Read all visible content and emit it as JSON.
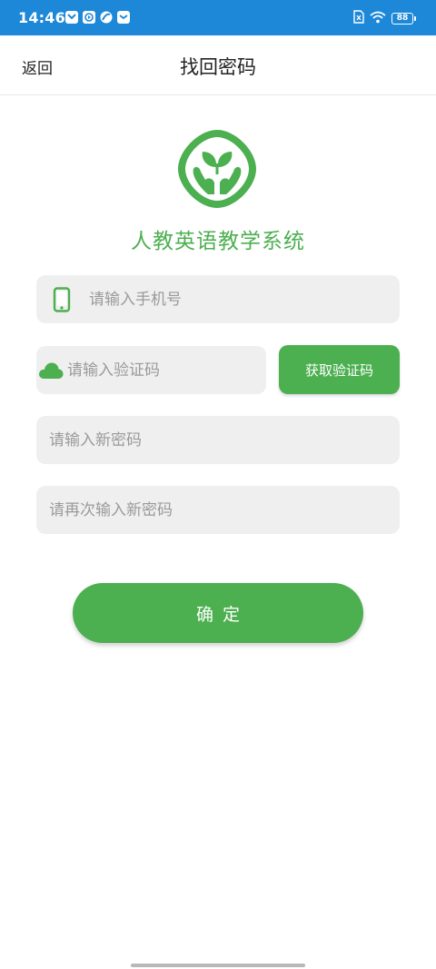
{
  "status_bar": {
    "time": "14:46",
    "battery": "88",
    "icons": [
      "message-app-icon",
      "video-app-icon",
      "browser-app-icon",
      "mail-app-icon",
      "sim-icon",
      "wifi-icon",
      "battery-icon"
    ]
  },
  "header": {
    "back_label": "返回",
    "title": "找回密码"
  },
  "brand": {
    "app_name": "人教英语教学系统",
    "logo_icon": "sprout-hands-logo",
    "color": "#4caf50"
  },
  "form": {
    "phone_placeholder": "请输入手机号",
    "code_placeholder": "请输入验证码",
    "get_code_label": "获取验证码",
    "new_password_placeholder": "请输入新密码",
    "confirm_password_placeholder": "请再次输入新密码",
    "submit_label": "确定"
  },
  "colors": {
    "status_bar": "#1e88d8",
    "accent": "#4caf50",
    "input_bg": "#efefef"
  }
}
